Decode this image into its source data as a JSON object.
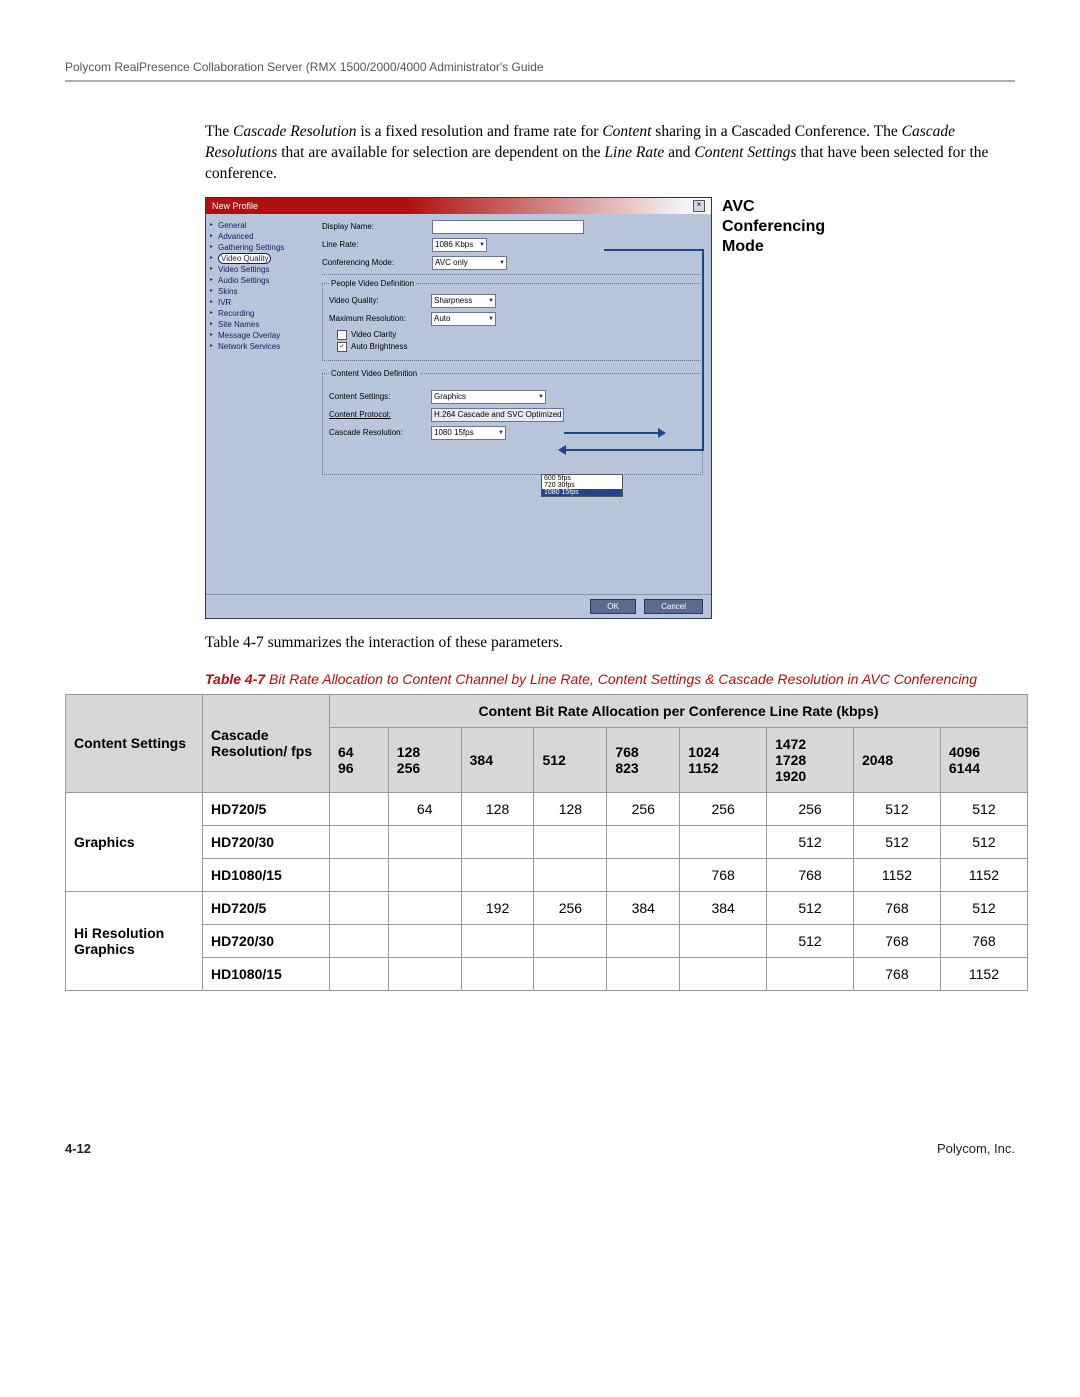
{
  "header": "Polycom RealPresence Collaboration Server (RMX 1500/2000/4000 Administrator's Guide",
  "paragraph": {
    "t1": "The ",
    "i1": "Cascade Resolution",
    "t2": " is a fixed resolution and frame rate for ",
    "i2": "Content",
    "t3": " sharing in a Cascaded Conference. The ",
    "i3": "Cascade Resolutions",
    "t4": " that are available for selection are dependent on the ",
    "i4": "Line Rate",
    "t5": " and ",
    "i5": "Content Settings",
    "t6": " that have been selected for the conference."
  },
  "sideCaption": {
    "l1": "AVC",
    "l2": "Conferencing",
    "l3": "Mode"
  },
  "dialog": {
    "title": "New Profile",
    "nav": [
      "General",
      "Advanced",
      "Gathering Settings",
      "Video Quality",
      "Video Settings",
      "Audio Settings",
      "Skins",
      "IVR",
      "Recording",
      "Site Names",
      "Message Overlay",
      "Network Services"
    ],
    "selectedNav": "Video Quality",
    "labels": {
      "displayName": "Display Name:",
      "lineRate": "Line Rate:",
      "confMode": "Conferencing Mode:",
      "pvd": "People Video Definition",
      "videoQuality": "Video Quality:",
      "maxRes": "Maximum Resolution:",
      "videoClarity": "Video Clarity",
      "autoBright": "Auto Brightness",
      "cvd": "Content Video Definition",
      "contentSettings": "Content Settings:",
      "contentProtocol": "Content Protocol:",
      "cascadeRes": "Cascade Resolution:"
    },
    "values": {
      "lineRate": "1086 Kbps",
      "confMode": "AVC only",
      "videoQuality": "Sharpness",
      "maxRes": "Auto",
      "contentSettings": "Graphics",
      "contentProtocol": "H.264 Cascade and SVC Optimized",
      "cascadeRes": "1080 15fps"
    },
    "dropdown": [
      "600 5fps",
      "720 30fps",
      "1080 15fps"
    ],
    "buttons": {
      "ok": "OK",
      "cancel": "Cancel"
    }
  },
  "midText": "Table 4-7 summarizes the interaction of these parameters.",
  "tableCaption": {
    "lead": "Table 4-7",
    "rest": " Bit Rate Allocation to Content Channel by Line Rate, Content Settings & Cascade Resolution in AVC Conferencing"
  },
  "table": {
    "spanHeader": "Content Bit Rate Allocation per Conference Line Rate (kbps)",
    "rowHead1": "Content Settings",
    "rowHead2": "Cascade Resolution/ fps",
    "cols": [
      {
        "l1": "64",
        "l2": "96"
      },
      {
        "l1": "128",
        "l2": "256"
      },
      {
        "l1": "384",
        "l2": ""
      },
      {
        "l1": "512",
        "l2": ""
      },
      {
        "l1": "768",
        "l2": "823"
      },
      {
        "l1": "1024",
        "l2": "1152"
      },
      {
        "l1": "1472",
        "l2": "1728",
        "l3": "1920"
      },
      {
        "l1": "2048",
        "l2": ""
      },
      {
        "l1": "4096",
        "l2": "6144"
      }
    ],
    "groups": [
      {
        "name": "Graphics",
        "rows": [
          {
            "res": "HD720/5",
            "v": [
              "",
              "64",
              "128",
              "128",
              "256",
              "256",
              "256",
              "512",
              "512"
            ]
          },
          {
            "res": "HD720/30",
            "v": [
              "",
              "",
              "",
              "",
              "",
              "",
              "512",
              "512",
              "512"
            ]
          },
          {
            "res": "HD1080/15",
            "v": [
              "",
              "",
              "",
              "",
              "",
              "768",
              "768",
              "1152",
              "1152"
            ]
          }
        ]
      },
      {
        "name": "Hi Resolution Graphics",
        "rows": [
          {
            "res": "HD720/5",
            "v": [
              "",
              "",
              "192",
              "256",
              "384",
              "384",
              "512",
              "768",
              "512"
            ]
          },
          {
            "res": "HD720/30",
            "v": [
              "",
              "",
              "",
              "",
              "",
              "",
              "512",
              "768",
              "768"
            ]
          },
          {
            "res": "HD1080/15",
            "v": [
              "",
              "",
              "",
              "",
              "",
              "",
              "",
              "768",
              "1152"
            ]
          }
        ]
      }
    ]
  },
  "footer": {
    "page": "4-12",
    "company": "Polycom, Inc."
  }
}
